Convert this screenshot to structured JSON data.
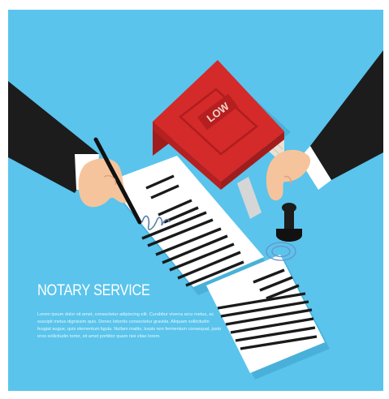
{
  "illustration": {
    "background_color": "#5ac4ec",
    "book_color": "#d42a2a",
    "book_label": "LOW",
    "title": "NOTARY SERVICE",
    "body_text": "Lorem ipsum dolor sit amet, consectetur adipiscing elit. Curabitur viverra arcu metus, ac suscipit metus dignissim quis. Donec lobortis consectetur gravida. Aliquam sollicitudin feugiat augue, quis elementum ligula. Nullam mattis, turpis non fermentum consequat, justo eros sollicitudin tortor, sit amet porttitor quam nisi vitae lorem."
  }
}
